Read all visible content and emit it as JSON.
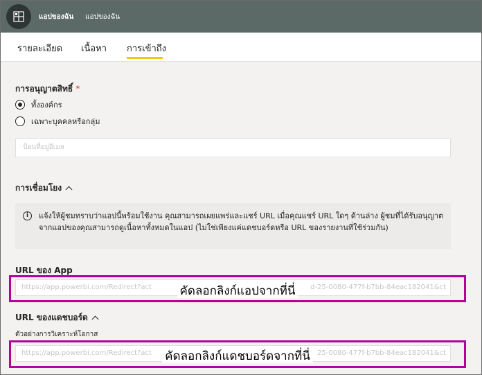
{
  "header": {
    "app_name": "แอปของฉัน",
    "breadcrumb": "แอปของฉัน",
    "icon": "app-grid-icon",
    "bg_color": "#5c6a67"
  },
  "tabs": [
    {
      "label": "รายละเอียด"
    },
    {
      "label": "เนื้อหา"
    },
    {
      "label": "การเข้าถึง",
      "active": true
    }
  ],
  "permissions": {
    "label": "การอนุญาตสิทธิ์",
    "required_mark": "*",
    "options": [
      {
        "label": "ทั้งองค์กร",
        "selected": true
      },
      {
        "label": "เฉพาะบุคคลหรือกลุ่ม",
        "selected": false
      }
    ],
    "email_placeholder": "ป้อนที่อยู่อีเมล"
  },
  "links": {
    "label": "การเชื่อมโยง",
    "info_text": "แจ้งให้ผู้ชมทราบว่าแอปนี้พร้อมใช้งาน คุณสามารถเผยแพร่และแชร์ URL เมื่อคุณแชร์ URL ใดๆ ด้านล่าง ผู้ชมที่ได้รับอนุญาตจากแอปของคุณสามารถดูเนื้อหาทั้งหมดในแอป (ไม่ใช่เพียงแค่แดชบอร์ดหรือ URL ของรายงานที่ใช้ร่วมกัน)",
    "app_url_label": "URL ของ App",
    "app_url_value": "https://app.powerbi.com/Redirect?action=OpenApp&appId=...d-25-0080-477f-b7bb-84eac182041&ctid",
    "app_url_value_left": "https://app.powerbi.com/Redirect?act",
    "app_url_value_right": "d-25-0080-477f-b7bb-84eac182041&ct",
    "app_overlay": "คัดลอกลิงก์แอปจากที่นี่",
    "dashboard_url_label": "URL ของแดชบอร์ด",
    "dashboard_name": "ตัวอย่างการวิเคราะห์โอกาส",
    "dashboard_url_value_left": "https://app.powerbi.com/Redirect?act",
    "dashboard_url_value_right": "25-0080-477f-b7bb-84eac182041&ct",
    "dashboard_overlay": "คัดลอกลิงก์แดชบอร์ดจากที่นี่"
  },
  "colors": {
    "accent": "#f2c811",
    "highlight": "#b4009e",
    "required": "#d13438"
  }
}
